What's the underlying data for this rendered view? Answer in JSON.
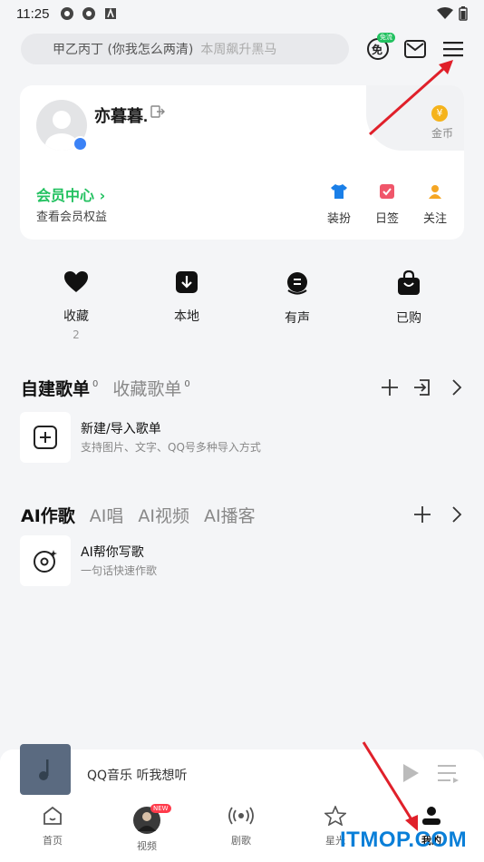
{
  "status_bar": {
    "time": "11:25"
  },
  "search": {
    "query": "甲乙丙丁 (你我怎么两清)",
    "hint": "本周飙升黑马"
  },
  "header": {
    "free_badge": "免流",
    "free_icon_text": "免"
  },
  "profile": {
    "username": "亦暮暮.",
    "coin_label": "金币",
    "coin_symbol": "¥",
    "vip_title": "会员中心 ›",
    "vip_subtitle": "查看会员权益",
    "actions": [
      {
        "label": "装扮",
        "color": "#1a7fe8"
      },
      {
        "label": "日签",
        "color": "#f0566a"
      },
      {
        "label": "关注",
        "color": "#f5a623"
      }
    ]
  },
  "quick_links": [
    {
      "label": "收藏",
      "count": "2"
    },
    {
      "label": "本地",
      "count": ""
    },
    {
      "label": "有声",
      "count": ""
    },
    {
      "label": "已购",
      "count": ""
    }
  ],
  "playlists": {
    "tab_created": "自建歌单",
    "tab_created_count": "0",
    "tab_collected": "收藏歌单",
    "tab_collected_count": "0",
    "item_title": "新建/导入歌单",
    "item_subtitle": "支持图片、文字、QQ号多种导入方式"
  },
  "ai": {
    "tabs": [
      "AI作歌",
      "AI唱",
      "AI视频",
      "AI播客"
    ],
    "item_title": "AI帮你写歌",
    "item_subtitle": "一句话快速作歌"
  },
  "player": {
    "text": "QQ音乐 听我想听"
  },
  "bottom_nav": {
    "items": [
      {
        "label": "首页",
        "icon": "home-icon"
      },
      {
        "label": "视频",
        "icon": "video-avatar"
      },
      {
        "label": "剧歌",
        "icon": "radio-icon"
      },
      {
        "label": "星光",
        "icon": "star-icon"
      },
      {
        "label": "我的",
        "icon": "person-icon"
      }
    ],
    "new_badge": "NEW"
  },
  "watermark": "ITMOP.COM",
  "colors": {
    "accent": "#22c160",
    "arrow": "#e0202a",
    "watermark": "#0a7fd8"
  }
}
